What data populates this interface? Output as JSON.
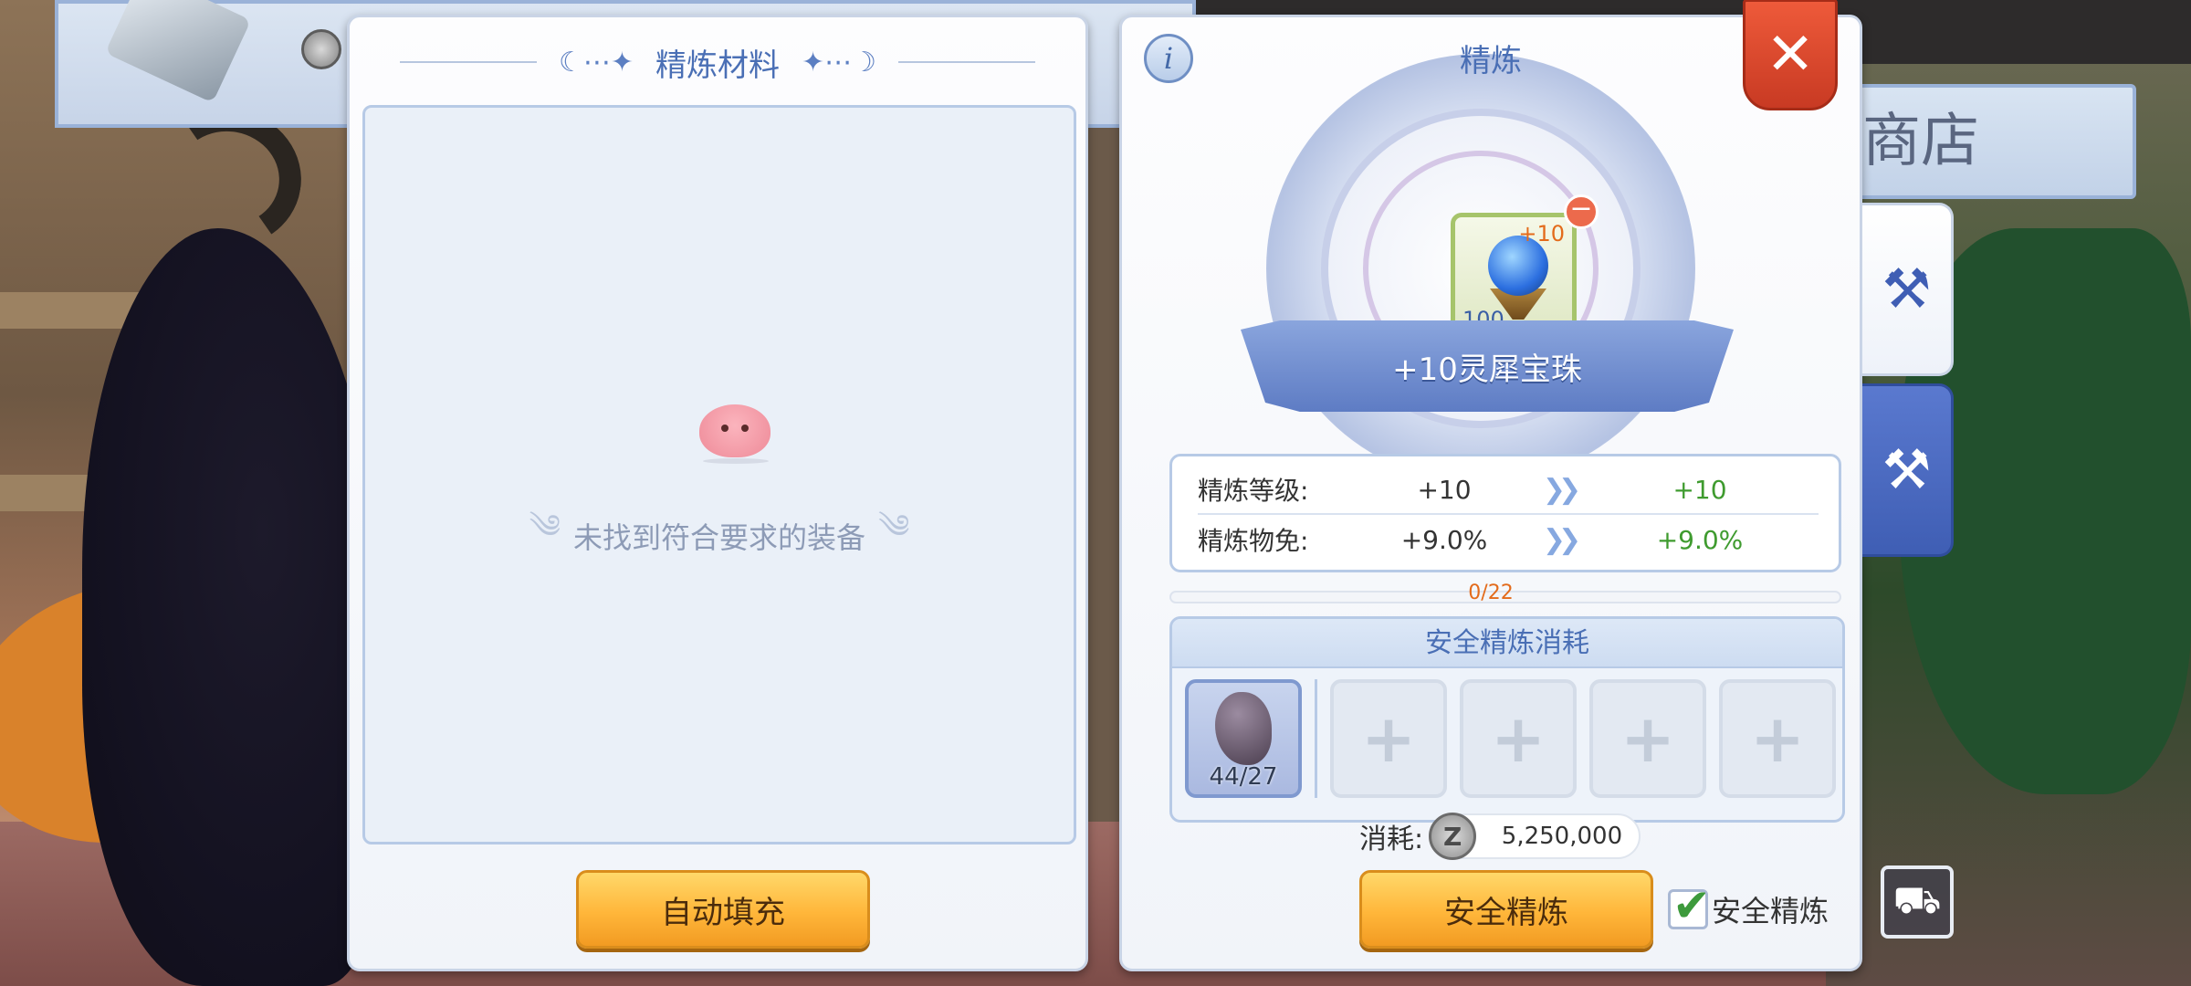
{
  "background": {
    "shop_sign": "商店"
  },
  "materials_panel": {
    "title": "精炼材料",
    "empty_message": "未找到符合要求的装备",
    "auto_fill_label": "自动填充"
  },
  "refine_panel": {
    "title": "精炼",
    "info_icon": "info-icon",
    "close_icon": "close-icon",
    "item": {
      "name": "+10灵犀宝珠",
      "refine_badge": "+10",
      "quantity": "100"
    },
    "stats": [
      {
        "label": "精炼等级:",
        "current": "+10",
        "next": "+10"
      },
      {
        "label": "精炼物免:",
        "current": "+9.0%",
        "next": "+9.0%"
      }
    ],
    "progress": {
      "text": "0/22",
      "value": 0,
      "max": 22
    },
    "safe_cost": {
      "title": "安全精炼消耗",
      "material_count": "44/27",
      "empty_slot_icon": "plus-icon"
    },
    "fee": {
      "label": "消耗:",
      "currency_symbol": "Z",
      "amount": "5,250,000"
    },
    "safe_refine_button": "安全精炼",
    "safe_refine_checkbox": {
      "label": "安全精炼",
      "checked": true
    }
  },
  "side_tabs": [
    {
      "name": "refine",
      "icon": "hammer-icon",
      "active": false
    },
    {
      "name": "upgrade",
      "icon": "hammer-plus-icon",
      "active": true
    }
  ],
  "colors": {
    "accent_blue": "#4a6fb5",
    "button_orange": "#ffb63a",
    "close_red": "#e04a2e",
    "next_value_green": "#3f9b2f",
    "progress_orange": "#e36b1b"
  }
}
